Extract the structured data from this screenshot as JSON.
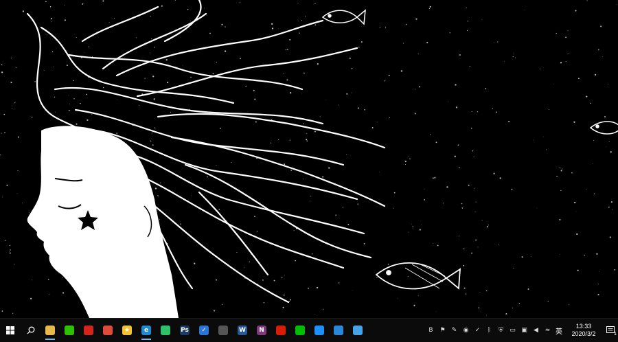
{
  "taskbar": {
    "apps": [
      {
        "name": "file-explorer",
        "color": "#e9b84a",
        "glyph": "",
        "running": true
      },
      {
        "name": "wechat",
        "color": "#2dc100",
        "glyph": "",
        "running": false
      },
      {
        "name": "acrobat",
        "color": "#d4251c",
        "glyph": "",
        "running": false
      },
      {
        "name": "chrome",
        "color": "#e04a3a",
        "glyph": "",
        "running": false
      },
      {
        "name": "favorites",
        "color": "#f4c430",
        "glyph": "★",
        "running": false
      },
      {
        "name": "edge",
        "color": "#1f8ad2",
        "glyph": "e",
        "running": true
      },
      {
        "name": "notes",
        "color": "#30c26a",
        "glyph": "",
        "running": false
      },
      {
        "name": "photoshop",
        "color": "#1b3a66",
        "glyph": "Ps",
        "running": false
      },
      {
        "name": "tasks",
        "color": "#2c75d6",
        "glyph": "✓",
        "running": false
      },
      {
        "name": "keyboard",
        "color": "#555555",
        "glyph": "",
        "running": false
      },
      {
        "name": "word",
        "color": "#2b5797",
        "glyph": "W",
        "running": false
      },
      {
        "name": "onenote",
        "color": "#80397b",
        "glyph": "N",
        "running": false
      },
      {
        "name": "netease-music",
        "color": "#d81e06",
        "glyph": "",
        "running": false
      },
      {
        "name": "iqiyi",
        "color": "#00be06",
        "glyph": "",
        "running": false
      },
      {
        "name": "browser",
        "color": "#1e90ff",
        "glyph": "",
        "running": false
      },
      {
        "name": "mail-app",
        "color": "#2b88d8",
        "glyph": "",
        "running": false
      },
      {
        "name": "chat-app",
        "color": "#46a3e8",
        "glyph": "",
        "running": false
      }
    ],
    "tray": {
      "icons": [
        "b-icon",
        "flag-icon",
        "pen-icon",
        "wechat-tray-icon",
        "check-tray-icon",
        "bluetooth-icon",
        "shield-icon",
        "battery-icon",
        "network-icon",
        "speaker-icon",
        "wifi-icon"
      ],
      "ime": "英",
      "time": "13:33",
      "date": "2020/3/2",
      "notification_count": "1"
    }
  }
}
